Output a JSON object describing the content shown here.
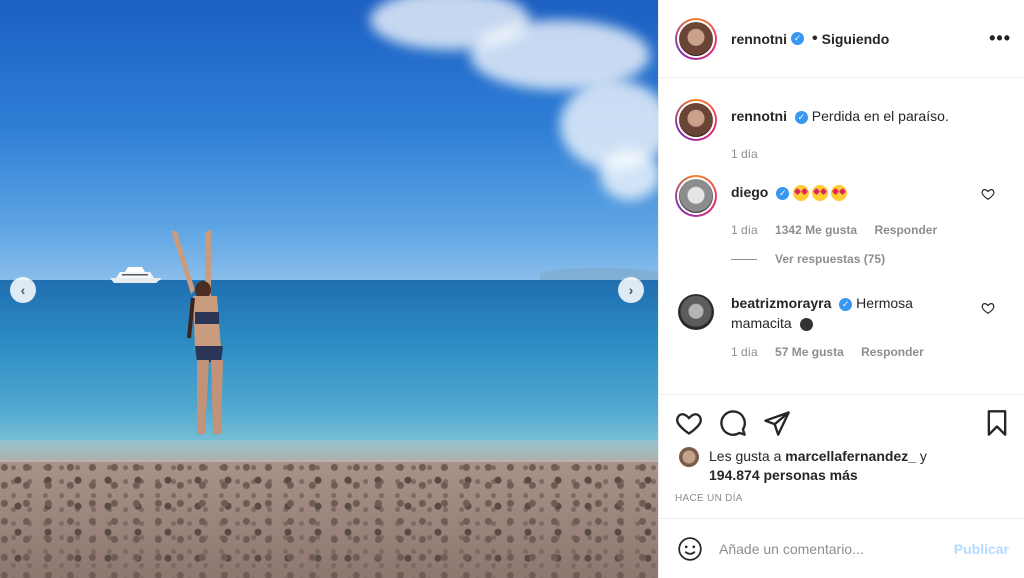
{
  "post": {
    "username": "rennotni",
    "follow_separator": "•",
    "follow_status": "Siguiendo",
    "more_label": "•••",
    "caption": "Perdida en el paraíso.",
    "caption_time": "1 día"
  },
  "comments": [
    {
      "username": "diego",
      "text": "",
      "emojis": [
        "star-struck",
        "star-struck",
        "star-struck"
      ],
      "time": "1 día",
      "likes": "1342 Me gusta",
      "reply_label": "Responder",
      "view_replies": "Ver respuestas (75)"
    },
    {
      "username": "beatrizmorayra",
      "text": "Hermosa mamacita",
      "emojis": [
        "bomb"
      ],
      "time": "1 día",
      "likes": "57 Me gusta",
      "reply_label": "Responder"
    }
  ],
  "actions": {
    "liked_by_prefix": "Les gusta a",
    "liked_by_user": "marcellafernandez_",
    "liked_by_and": "y",
    "others_count": "194.874 personas más",
    "posted_ago": "HACE UN DÍA"
  },
  "comment_box": {
    "placeholder": "Añade un comentario...",
    "publish_label": "Publicar"
  },
  "colors": {
    "verified": "#3897f0",
    "publish_disabled": "#b3dbff",
    "muted_text": "#8e8e8e"
  }
}
